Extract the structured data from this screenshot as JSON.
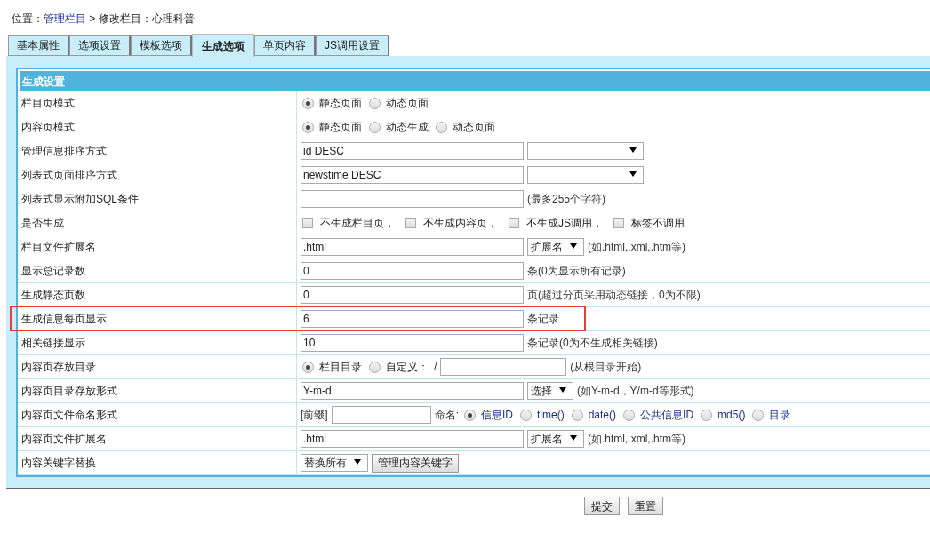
{
  "breadcrumb": [
    {
      "text": "位置：",
      "link": false
    },
    {
      "text": "管理栏目",
      "link": true
    },
    {
      "text": " > 修改栏目：心理科普",
      "link": false
    }
  ],
  "tabs": [
    {
      "label": "基本属性",
      "selected": false
    },
    {
      "label": "选项设置",
      "selected": false
    },
    {
      "label": "模板选项",
      "selected": false
    },
    {
      "label": "生成选项",
      "selected": true
    },
    {
      "label": "单页内容",
      "selected": false
    },
    {
      "label": "JS调用设置",
      "selected": false
    }
  ],
  "section_title": "生成设置",
  "rows": [
    {
      "label": "栏目页模式",
      "controls": [
        {
          "kind": "radio",
          "label": "静态页面",
          "checked": true
        },
        {
          "kind": "radio",
          "label": "动态页面",
          "checked": false
        }
      ]
    },
    {
      "label": "内容页模式",
      "controls": [
        {
          "kind": "radio",
          "label": "静态页面",
          "checked": true
        },
        {
          "kind": "radio",
          "label": "动态生成",
          "checked": false
        },
        {
          "kind": "radio",
          "label": "动态页面",
          "checked": false
        }
      ]
    },
    {
      "label": "管理信息排序方式",
      "controls": [
        {
          "kind": "text",
          "value": "id DESC"
        },
        {
          "kind": "wideselect"
        }
      ]
    },
    {
      "label": "列表式页面排序方式",
      "controls": [
        {
          "kind": "text",
          "value": "newstime DESC"
        },
        {
          "kind": "wideselect"
        }
      ]
    },
    {
      "label": "列表式显示附加SQL条件",
      "controls": [
        {
          "kind": "text"
        },
        {
          "kind": "note",
          "text": "(最多255个字符)"
        }
      ]
    },
    {
      "label": "是否生成",
      "controls": [
        {
          "kind": "checkbox",
          "label": "不生成栏目页，",
          "checked": false
        },
        {
          "kind": "checkbox",
          "label": "不生成内容页，",
          "checked": false
        },
        {
          "kind": "checkbox",
          "label": "不生成JS调用，",
          "checked": false
        },
        {
          "kind": "checkbox",
          "label": "标签不调用",
          "checked": false
        }
      ]
    },
    {
      "label": "栏目文件扩展名",
      "controls": [
        {
          "kind": "text",
          "value": ".html"
        },
        {
          "kind": "select",
          "value": "扩展名"
        },
        {
          "kind": "note",
          "text": "(如.html,.xml,.htm等)"
        }
      ]
    },
    {
      "label": "显示总记录数",
      "controls": [
        {
          "kind": "text",
          "value": "0"
        },
        {
          "kind": "note",
          "text": "条(0为显示所有记录)"
        }
      ]
    },
    {
      "label": "生成静态页数",
      "controls": [
        {
          "kind": "text",
          "value": "0"
        },
        {
          "kind": "note",
          "text": "页(超过分页采用动态链接，0为不限)"
        }
      ]
    },
    {
      "label": "生成信息每页显示",
      "highlighted": true,
      "controls": [
        {
          "kind": "text",
          "value": "6"
        },
        {
          "kind": "note",
          "text": "条记录"
        }
      ]
    },
    {
      "label": "相关链接显示",
      "controls": [
        {
          "kind": "text",
          "value": "10"
        },
        {
          "kind": "note",
          "text": "条记录(0为不生成相关链接)"
        }
      ]
    },
    {
      "label": "内容页存放目录",
      "controls": [
        {
          "kind": "radio",
          "label": "栏目目录",
          "checked": true
        },
        {
          "kind": "radio",
          "label": "自定义：",
          "checked": false
        },
        {
          "kind": "note",
          "text": "/"
        },
        {
          "kind": "midtext"
        },
        {
          "kind": "note",
          "text": "(从根目录开始)"
        }
      ]
    },
    {
      "label": "内容页目录存放形式",
      "controls": [
        {
          "kind": "text",
          "value": "Y-m-d"
        },
        {
          "kind": "select",
          "value": "选择"
        },
        {
          "kind": "note",
          "text": "(如Y-m-d，Y/m-d等形式)"
        }
      ]
    },
    {
      "label": "内容页文件命名形式",
      "controls": [
        {
          "kind": "note",
          "text": "[前缀]"
        },
        {
          "kind": "smalltext"
        },
        {
          "kind": "note",
          "text": "命名:"
        },
        {
          "kind": "radio",
          "label": "信息ID",
          "checked": true,
          "link": true
        },
        {
          "kind": "radio",
          "label": "time()",
          "checked": false,
          "link": true
        },
        {
          "kind": "radio",
          "label": "date()",
          "checked": false,
          "link": true
        },
        {
          "kind": "radio",
          "label": "公共信息ID",
          "checked": false,
          "link": true
        },
        {
          "kind": "radio",
          "label": "md5()",
          "checked": false,
          "link": true
        },
        {
          "kind": "radio",
          "label": "目录",
          "checked": false,
          "link": true
        }
      ]
    },
    {
      "label": "内容页文件扩展名",
      "controls": [
        {
          "kind": "text",
          "value": ".html"
        },
        {
          "kind": "select",
          "value": "扩展名"
        },
        {
          "kind": "note",
          "text": "(如.html,.xml,.htm等)"
        }
      ]
    },
    {
      "label": "内容关键字替换",
      "controls": [
        {
          "kind": "select",
          "value": "替换所有"
        },
        {
          "kind": "button",
          "label": "管理内容关键字"
        }
      ]
    }
  ],
  "buttons": [
    "提交",
    "重置"
  ]
}
